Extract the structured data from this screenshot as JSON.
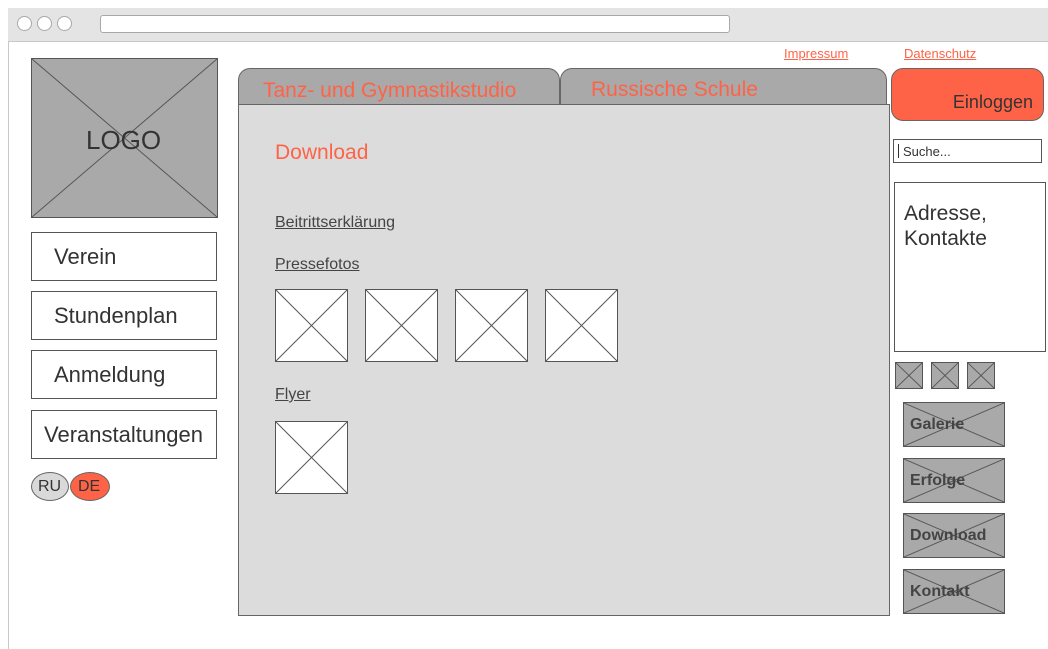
{
  "top_links": {
    "impressum": "Impressum",
    "datenschutz": "Datenschutz"
  },
  "logo": {
    "label": "LOGO"
  },
  "nav": [
    {
      "label": "Verein"
    },
    {
      "label": "Stundenplan"
    },
    {
      "label": "Anmeldung"
    },
    {
      "label": "Veranstaltungen"
    }
  ],
  "languages": {
    "ru": "RU",
    "de": "DE",
    "active": "DE"
  },
  "tabs": [
    {
      "label": "Tanz- und Gymnastikstudio"
    },
    {
      "label": "Russische Schule"
    }
  ],
  "login": {
    "label": "Einloggen"
  },
  "search": {
    "placeholder": "Suche..."
  },
  "address_box": {
    "text": "Adresse, Kontakte"
  },
  "main": {
    "heading": "Download",
    "links": {
      "beitritt": "Beitrittserklärung",
      "pressefotos": "Pressefotos",
      "flyer": "Flyer"
    }
  },
  "side_buttons": [
    {
      "label": "Galerie"
    },
    {
      "label": "Erfolge"
    },
    {
      "label": "Download"
    },
    {
      "label": "Kontakt"
    }
  ],
  "colors": {
    "accent": "#ff6347",
    "gray": "#a9a9a9",
    "content_bg": "#dcdcdc"
  }
}
